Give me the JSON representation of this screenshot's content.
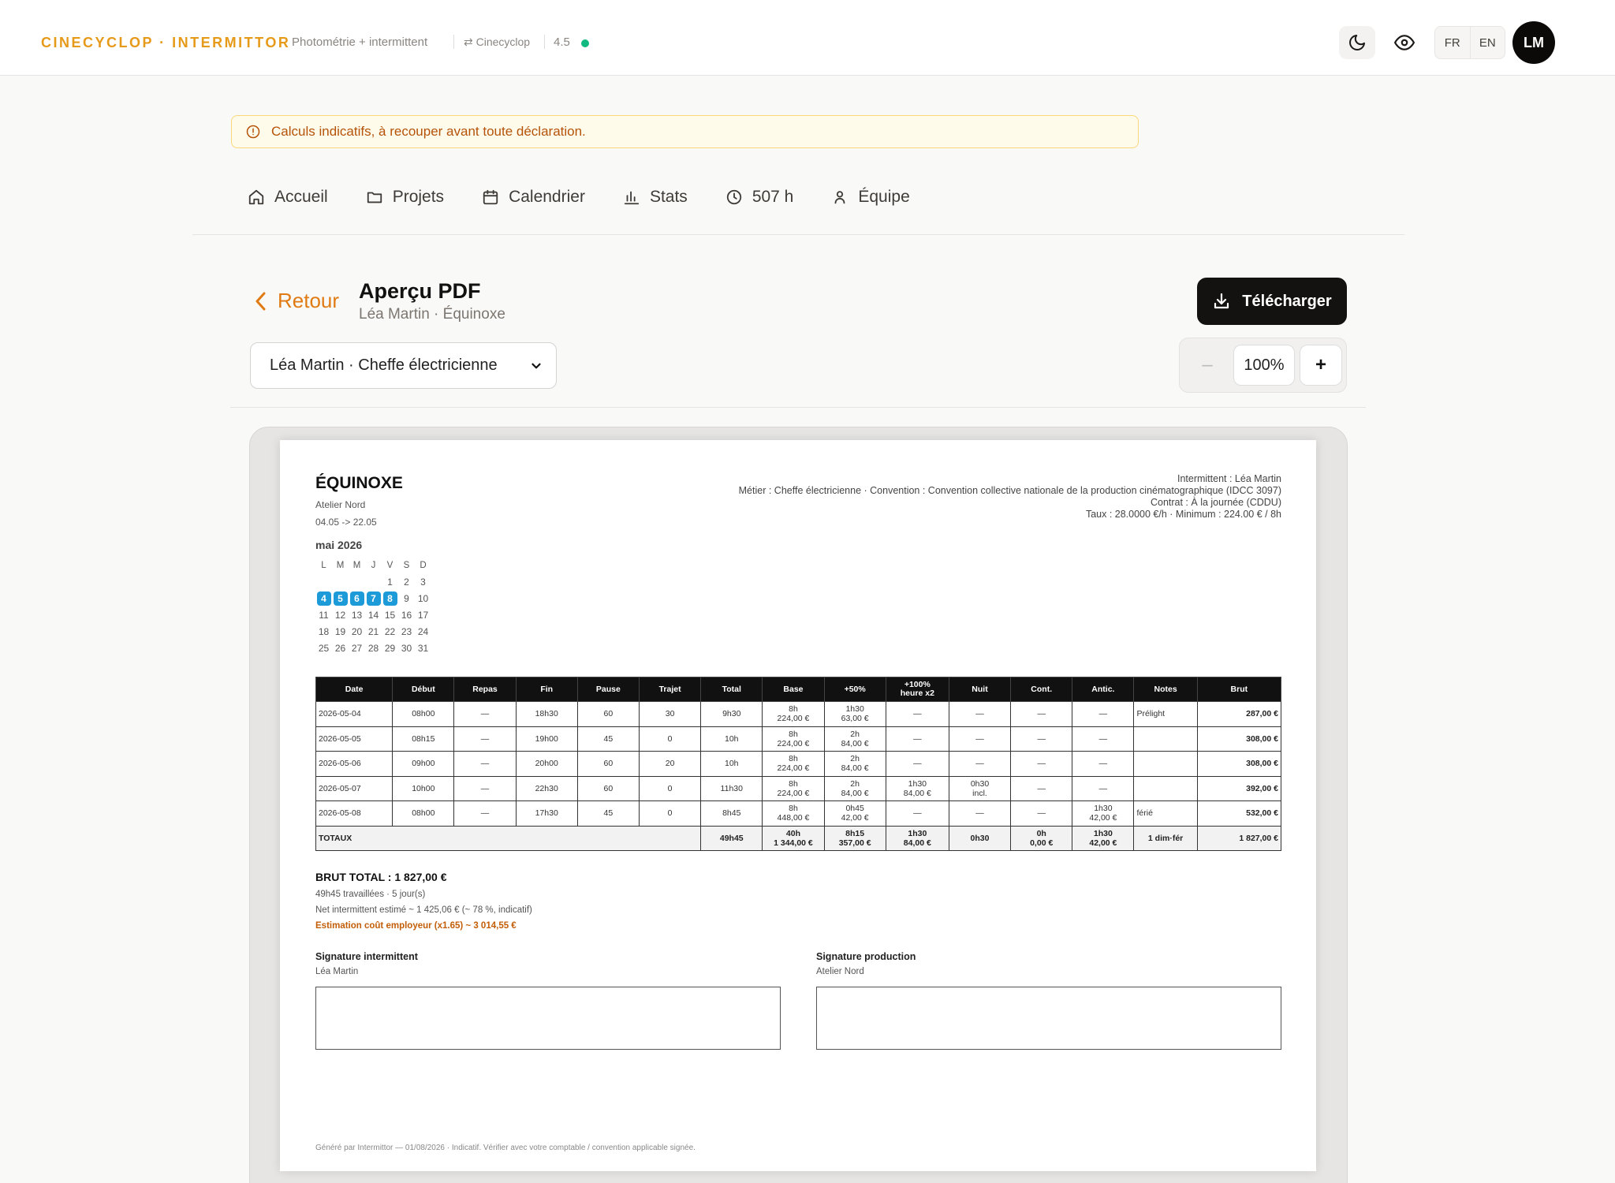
{
  "header": {
    "brand": "CINECYCLOP · INTERMITTOR",
    "subtitle": "Photométrie + intermittent",
    "switch_label": "⇄ Cinecyclop",
    "version": "4.5",
    "status_color": "#10b981",
    "lang_fr": "FR",
    "lang_en": "EN",
    "avatar": "LM"
  },
  "warning": "Calculs indicatifs, à recouper avant toute déclaration.",
  "nav": {
    "home": "Accueil",
    "projects": "Projets",
    "calendar": "Calendrier",
    "stats": "Stats",
    "hours": "507 h",
    "team": "Équipe"
  },
  "page": {
    "back": "Retour",
    "title": "Aperçu PDF",
    "subtitle": "Léa Martin · Équinoxe",
    "download": "Télécharger",
    "selected_person": "Léa Martin · Cheffe électricienne",
    "zoom_minus": "–",
    "zoom_value": "100%",
    "zoom_plus": "+"
  },
  "doc": {
    "company": "ÉQUINOXE",
    "production": "Atelier Nord",
    "period": "04.05 -> 22.05",
    "info1": "Intermittent : Léa Martin",
    "info2": "Métier : Cheffe électricienne · Convention : Convention collective nationale de la production cinématographique (IDCC 3097)",
    "info3": "Contrat : À la journée (CDDU)",
    "info4": "Taux : 28.0000 €/h · Minimum : 224.00 € / 8h",
    "month": "mai 2026",
    "weekdays": [
      "L",
      "M",
      "M",
      "J",
      "V",
      "S",
      "D"
    ],
    "calendar_rows": [
      [
        "",
        "",
        "",
        "",
        "1",
        "2",
        "3"
      ],
      [
        "4",
        "5",
        "6",
        "7",
        "8",
        "9",
        "10"
      ],
      [
        "11",
        "12",
        "13",
        "14",
        "15",
        "16",
        "17"
      ],
      [
        "18",
        "19",
        "20",
        "21",
        "22",
        "23",
        "24"
      ],
      [
        "25",
        "26",
        "27",
        "28",
        "29",
        "30",
        "31"
      ]
    ],
    "worked_days": [
      "4",
      "5",
      "6",
      "7",
      "8"
    ],
    "columns": [
      "Date",
      "Début",
      "Repas",
      "Fin",
      "Pause",
      "Trajet",
      "Total",
      "Base",
      "+50%",
      "+100% heure x2",
      "Nuit",
      "Cont.",
      "Antic.",
      "Notes",
      "Brut"
    ],
    "rows": [
      [
        "2026-05-04",
        "08h00",
        "—",
        "18h30",
        "60",
        "30",
        "9h30",
        "8h\n224,00 €",
        "1h30\n63,00 €",
        "—",
        "—",
        "—",
        "—",
        "Prélight",
        "287,00 €"
      ],
      [
        "2026-05-05",
        "08h15",
        "—",
        "19h00",
        "45",
        "0",
        "10h",
        "8h\n224,00 €",
        "2h\n84,00 €",
        "—",
        "—",
        "—",
        "—",
        "",
        "308,00 €"
      ],
      [
        "2026-05-06",
        "09h00",
        "—",
        "20h00",
        "60",
        "20",
        "10h",
        "8h\n224,00 €",
        "2h\n84,00 €",
        "—",
        "—",
        "—",
        "—",
        "",
        "308,00 €"
      ],
      [
        "2026-05-07",
        "10h00",
        "—",
        "22h30",
        "60",
        "0",
        "11h30",
        "8h\n224,00 €",
        "2h\n84,00 €",
        "1h30\n84,00 €",
        "0h30\nincl.",
        "—",
        "—",
        "",
        "392,00 €"
      ],
      [
        "2026-05-08",
        "08h00",
        "—",
        "17h30",
        "45",
        "0",
        "8h45",
        "8h\n448,00 €",
        "0h45\n42,00 €",
        "—",
        "—",
        "—",
        "1h30\n42,00 €",
        "férié",
        "532,00 €"
      ]
    ],
    "totals": {
      "label": "TOTAUX",
      "total": "49h45",
      "base": "40h\n1 344,00 €",
      "p50": "8h15\n357,00 €",
      "p100": "1h30\n84,00 €",
      "night": "0h30",
      "cont": "0h\n0,00 €",
      "antic": "1h30\n42,00 €",
      "notes": "1 dim·fér",
      "gross": "1 827,00 €"
    },
    "gross_total": "BRUT TOTAL : 1 827,00 €",
    "summary1": "49h45 travaillées · 5 jour(s)",
    "summary2": "Net intermittent estimé ~ 1 425,06 € (~ 78 %, indicatif)",
    "summary3": "Estimation coût employeur (x1.65) ~ 3 014,55 €",
    "sig_worker_title": "Signature intermittent",
    "sig_worker_name": "Léa Martin",
    "sig_prod_title": "Signature production",
    "sig_prod_name": "Atelier Nord",
    "footer": "Généré par Intermittor — 01/08/2026 · Indicatif. Vérifier avec votre comptable / convention applicable signée."
  }
}
